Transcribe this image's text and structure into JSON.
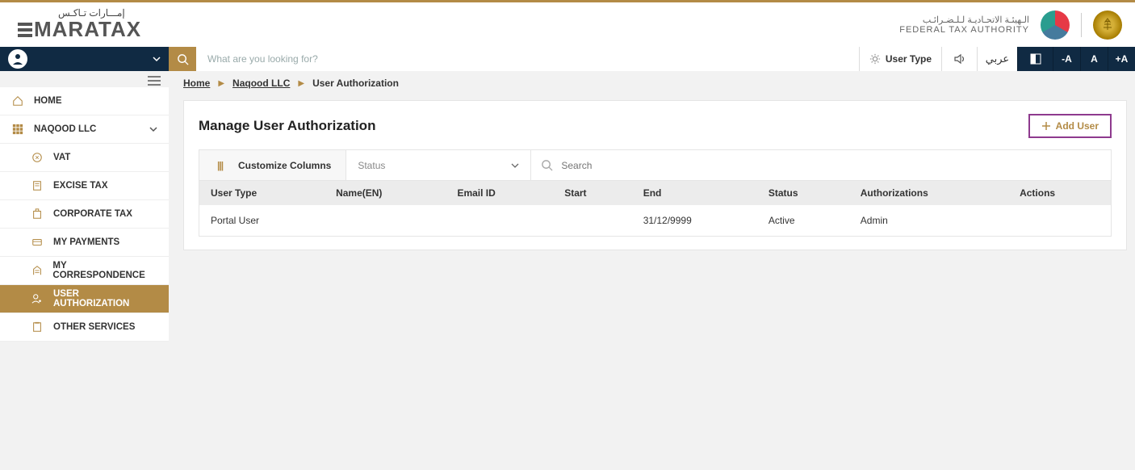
{
  "brand": {
    "logo_ar": "إمـــارات تـاكـس",
    "logo_en": "MARATAX"
  },
  "fta": {
    "line_ar": "الـهيئـة الاتحـاديـة لـلـضـرائـب",
    "line_en": "FEDERAL TAX AUTHORITY"
  },
  "topbar": {
    "search_placeholder": "What are you looking for?",
    "user_type_label": "User Type",
    "lang_label": "عربي",
    "font_minus": "-A",
    "font_normal": "A",
    "font_plus": "+A"
  },
  "sidebar": {
    "home": "HOME",
    "company": "NAQOOD LLC",
    "items": [
      {
        "label": "VAT"
      },
      {
        "label": "EXCISE TAX"
      },
      {
        "label": "CORPORATE TAX"
      },
      {
        "label": "MY PAYMENTS"
      },
      {
        "label": "MY CORRESPONDENCE"
      },
      {
        "label": "USER AUTHORIZATION"
      },
      {
        "label": "OTHER SERVICES"
      }
    ]
  },
  "breadcrumb": {
    "home": "Home",
    "company": "Naqood LLC",
    "page": "User Authorization"
  },
  "page": {
    "title": "Manage User Authorization",
    "add_user_label": "Add User",
    "customize_label": "Customize Columns",
    "status_placeholder": "Status",
    "search_placeholder": "Search"
  },
  "table": {
    "headers": {
      "user_type": "User Type",
      "name_en": "Name(EN)",
      "email_id": "Email ID",
      "start": "Start",
      "end": "End",
      "status": "Status",
      "authorizations": "Authorizations",
      "actions": "Actions"
    },
    "rows": [
      {
        "user_type": "Portal User",
        "name_en": "",
        "email_id": "",
        "start": "",
        "end": "31/12/9999",
        "status": "Active",
        "authorizations": "Admin",
        "actions": ""
      }
    ]
  }
}
